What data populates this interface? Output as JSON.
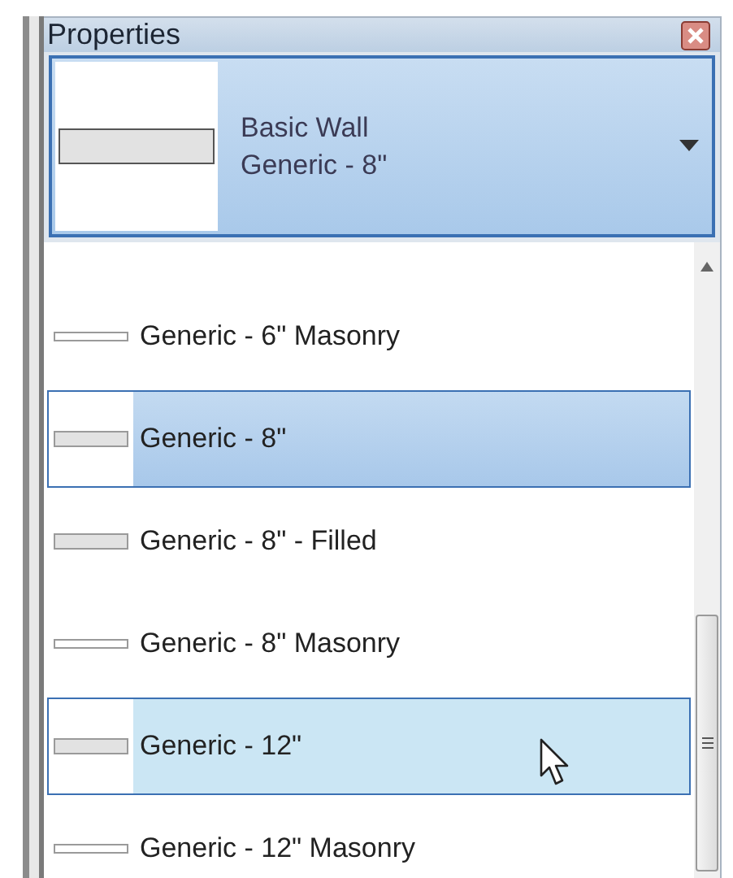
{
  "panel": {
    "title": "Properties"
  },
  "type_selector": {
    "family": "Basic Wall",
    "type": "Generic - 8\""
  },
  "types": [
    {
      "name": "Generic - 6\" Masonry",
      "kind": "thin",
      "selected": false,
      "hovered": false
    },
    {
      "name": "Generic - 8\"",
      "kind": "thick",
      "selected": true,
      "hovered": false
    },
    {
      "name": "Generic - 8\" - Filled",
      "kind": "thick",
      "selected": false,
      "hovered": false
    },
    {
      "name": "Generic - 8\" Masonry",
      "kind": "thin",
      "selected": false,
      "hovered": false
    },
    {
      "name": "Generic - 12\"",
      "kind": "thick",
      "selected": false,
      "hovered": true
    },
    {
      "name": "Generic - 12\" Masonry",
      "kind": "thin",
      "selected": false,
      "hovered": false
    }
  ]
}
